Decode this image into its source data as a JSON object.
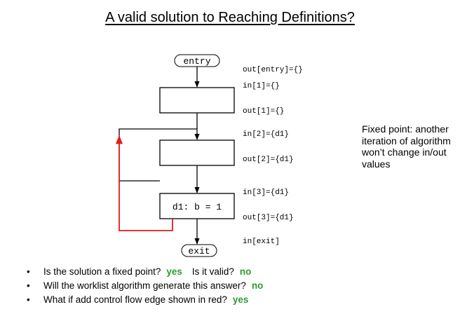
{
  "title": "A valid solution to Reaching Definitions?",
  "nodes": {
    "entry": "entry",
    "exit": "exit",
    "stmt": "d1: b = 1"
  },
  "annotations": {
    "out_entry": "out[entry]={}",
    "in_1": "in[1]={}",
    "out_1": "out[1]={}",
    "in_2": "in[2]={d1}",
    "out_2": "out[2]={d1}",
    "in_3": "in[3]={d1}",
    "out_3": "out[3]={d1}",
    "in_exit": "in[exit]"
  },
  "side_note": "Fixed point: another iteration of algorithm won’t change in/out values",
  "bullets": [
    {
      "q1": "Is the solution a fixed point?",
      "a1": "yes",
      "q2": "Is it valid?",
      "a2": "no"
    },
    {
      "q1": "Will the worklist algorithm generate this answer?",
      "a1": "no"
    },
    {
      "q1": "What if add control flow edge shown in red?",
      "a1": "yes"
    }
  ],
  "colors": {
    "edge": "#000000",
    "red_edge": "#e01b1b",
    "answer": "#2e9b2e"
  }
}
